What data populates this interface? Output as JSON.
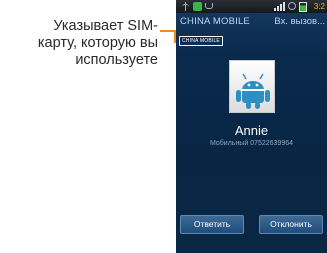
{
  "callout": {
    "line1": "Указывает SIM-",
    "line2": "карту, которую вы",
    "line3": "используете",
    "accent_color": "#f28c1e"
  },
  "statusbar": {
    "time": "3:2",
    "icons": [
      "usb-icon",
      "notification-icon",
      "phone-icon",
      "signal-icon",
      "alarm-icon",
      "battery-icon"
    ]
  },
  "call": {
    "carrier": "CHINA MOBILE",
    "state": "Вх. вызов...",
    "sim_badge": "CHINA MOBILE",
    "contact_name": "Annie",
    "number_line": "Мобильный 07522639964",
    "avatar_icon": "android-contact-icon"
  },
  "actions": {
    "answer_label": "Ответить",
    "decline_label": "Отклонить"
  }
}
